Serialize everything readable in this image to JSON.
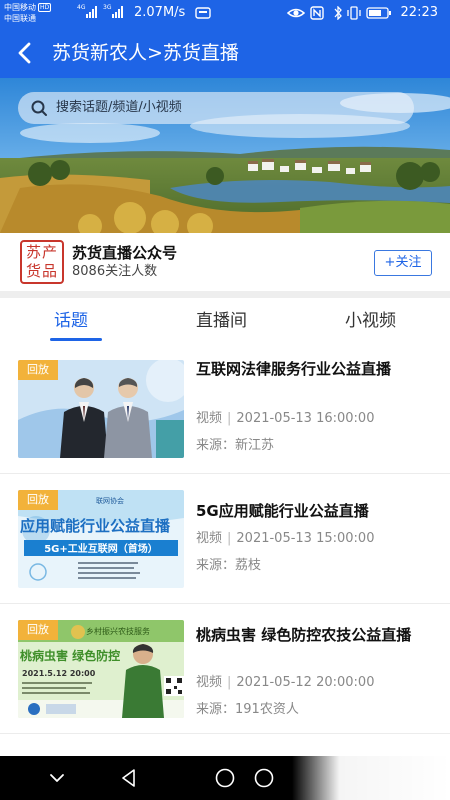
{
  "status_bar": {
    "carrier_1": "中国移动",
    "carrier_1_badge": "HD",
    "carrier_2": "中国联通",
    "network_1": "4G",
    "network_2": "3G",
    "speed": "2.07M/s",
    "time": "22:23",
    "icons": [
      "eye-icon",
      "nfc-icon",
      "vibrate-icon",
      "battery-icon"
    ]
  },
  "header": {
    "back_icon": "back-arrow-icon",
    "title": "苏货新农人>苏货直播",
    "background": "#1e64e6"
  },
  "search": {
    "icon": "search-icon",
    "placeholder": "搜索话题/频道/小视频"
  },
  "account": {
    "logo_line_1": "苏产",
    "logo_line_2": "货品",
    "name": "苏货直播公众号",
    "followers": "8086关注人数",
    "follow_label": "+关注"
  },
  "tabs": [
    {
      "label": "话题",
      "active": true
    },
    {
      "label": "直播间",
      "active": false
    },
    {
      "label": "小视频",
      "active": false
    }
  ],
  "feed": [
    {
      "tag": "回放",
      "title": "互联网法律服务行业公益直播",
      "type": "视频",
      "datetime": "2021-05-13 16:00:00",
      "source": "来源：新江苏"
    },
    {
      "tag": "回放",
      "title": "5G应用赋能行业公益直播",
      "type": "视频",
      "datetime": "2021-05-13 15:00:00",
      "source": "来源：荔枝"
    },
    {
      "tag": "回放",
      "title": "桃病虫害 绿色防控农技公益直播",
      "type": "视频",
      "datetime": "2021-05-12 20:00:00",
      "source": "来源：191农资人"
    }
  ],
  "thumb_text": {
    "t2_header": "联网协会",
    "t2_main": "应用赋能行业公益直播",
    "t2_sub": "5G+工业互联网（首场）",
    "t3_top": "乡村振兴农技服务",
    "t3_main": "桃病虫害 绿色防控",
    "t3_date": "2021.5.12 20:00"
  },
  "bottom_nav": [
    "collapse-icon",
    "back-triangle-icon",
    "home-circle-icon",
    "recents-circle-icon"
  ],
  "colors": {
    "accent": "#1e64e6",
    "tag": "#f2b23a",
    "logo": "#c8362c"
  }
}
